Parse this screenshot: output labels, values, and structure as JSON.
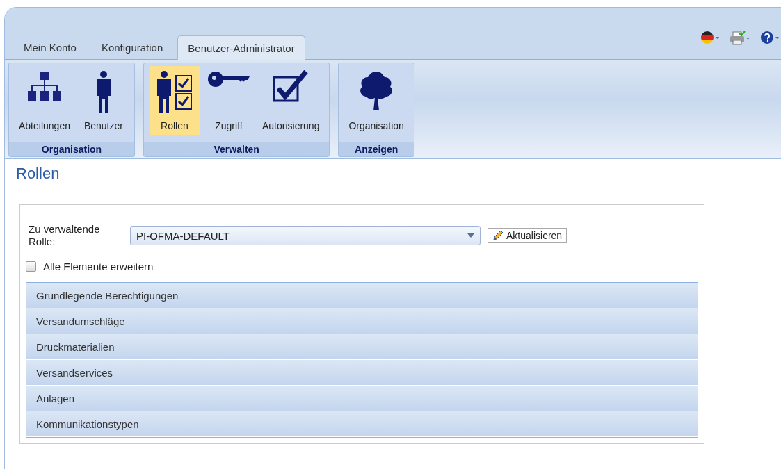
{
  "tabs": [
    {
      "label": "Mein Konto",
      "selected": false
    },
    {
      "label": "Konfiguration",
      "selected": false
    },
    {
      "label": "Benutzer-Administrator",
      "selected": true
    }
  ],
  "toolbar": [
    {
      "kind": "flag"
    },
    {
      "kind": "printer"
    },
    {
      "kind": "help"
    }
  ],
  "ribbon_groups": [
    {
      "title": "Organisation",
      "buttons": [
        {
          "label": "Abteilungen",
          "kind": "orgchart",
          "selected": false
        },
        {
          "label": "Benutzer",
          "kind": "person",
          "selected": false
        }
      ]
    },
    {
      "title": "Verwalten",
      "buttons": [
        {
          "label": "Rollen",
          "kind": "roles",
          "selected": true
        },
        {
          "label": "Zugriff",
          "kind": "key",
          "selected": false
        },
        {
          "label": "Autorisierung",
          "kind": "check",
          "selected": false
        }
      ]
    },
    {
      "title": "Anzeigen",
      "buttons": [
        {
          "label": "Organisation",
          "kind": "tree",
          "selected": false
        }
      ]
    }
  ],
  "page_title": "Rollen",
  "role_label": "Zu verwaltende Rolle:",
  "role_value": "PI-OFMA-DEFAULT",
  "refresh_button": "Aktualisieren",
  "expand_all": {
    "label": "Alle Elemente erweitern",
    "checked": false
  },
  "sections": [
    "Grundlegende Berechtigungen",
    "Versandumschläge",
    "Druckmaterialien",
    "Versandservices",
    "Anlagen",
    "Kommunikationstypen"
  ]
}
